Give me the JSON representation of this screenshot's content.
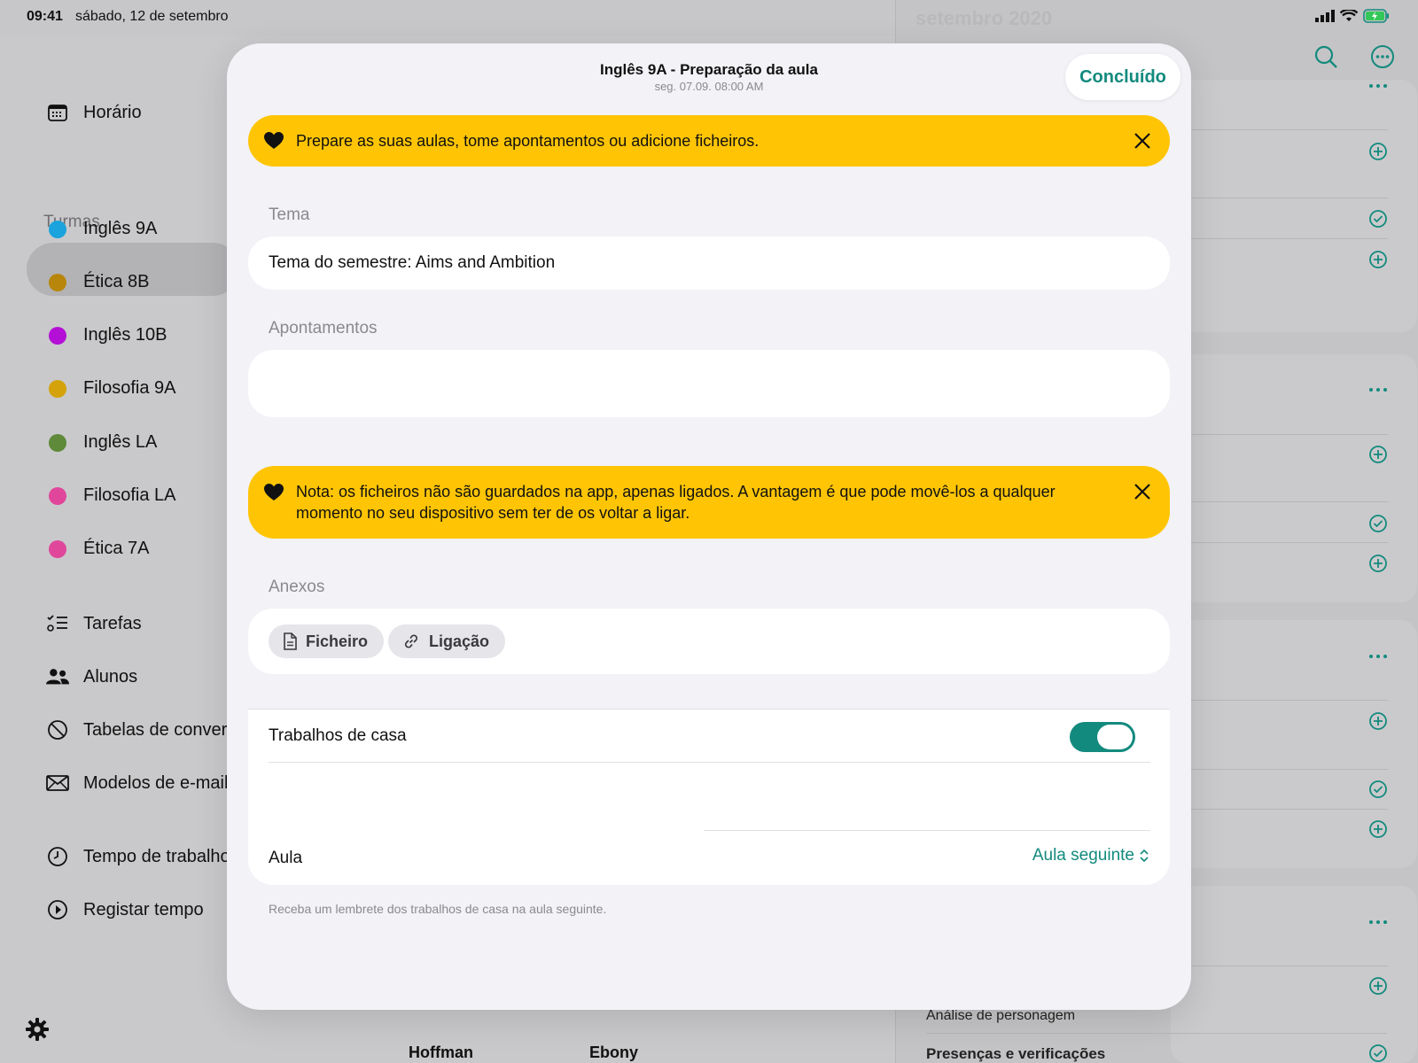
{
  "status_bar": {
    "time": "09:41",
    "date": "sábado, 12 de setembro"
  },
  "sidebar": {
    "schedule_label": "Horário",
    "classes_header": "Turmas",
    "classes": [
      {
        "label": "Inglês 9A",
        "color": "#1aa3dd",
        "selected": true
      },
      {
        "label": "Ética 8B",
        "color": "#b8860b"
      },
      {
        "label": "Inglês 10B",
        "color": "#b40fd6"
      },
      {
        "label": "Filosofia 9A",
        "color": "#d4a20a"
      },
      {
        "label": "Inglês LA",
        "color": "#5e8a3a"
      },
      {
        "label": "Filosofia LA",
        "color": "#e0479b"
      },
      {
        "label": "Ética 7A",
        "color": "#e0479b"
      }
    ],
    "tools": [
      {
        "label": "Tarefas",
        "icon": "checklist-icon"
      },
      {
        "label": "Alunos",
        "icon": "people-icon"
      },
      {
        "label": "Tabelas de convers",
        "icon": "gauge-icon"
      },
      {
        "label": "Modelos de e-mail",
        "icon": "envelope-icon"
      }
    ],
    "time_items": [
      {
        "label": "Tempo de trabalho",
        "icon": "clock-icon"
      },
      {
        "label": "Registar tempo",
        "icon": "play-circle-icon"
      }
    ]
  },
  "background": {
    "right_title": "setembro 2020",
    "bottom_names": [
      "Hoffman",
      "Ebony"
    ],
    "right_text_1": "Análise de personagem",
    "right_text_2": "Presenças e verificações"
  },
  "modal": {
    "title": "Inglês 9A - Preparação da aula",
    "subtitle": "seg. 07.09. 08:00 AM",
    "done_label": "Concluído",
    "banner_top": "Prepare as suas aulas, tome apontamentos ou adicione ficheiros.",
    "topic_label": "Tema",
    "topic_value": "Tema do semestre: Aims and Ambition",
    "notes_label": "Apontamentos",
    "banner_note": "Nota: os ficheiros não são guardados na app, apenas ligados. A vantagem é que pode movê-los a qualquer momento no seu dispositivo sem ter de os voltar a ligar.",
    "attachments_label": "Anexos",
    "file_label": "Ficheiro",
    "link_label": "Ligação",
    "homework_label": "Trabalhos de casa",
    "homework_enabled": true,
    "lesson_label": "Aula",
    "lesson_value": "Aula seguinte",
    "hint": "Receba um lembrete dos trabalhos de casa na aula seguinte."
  },
  "colors": {
    "accent": "#138a7e",
    "banner": "#ffc505"
  }
}
